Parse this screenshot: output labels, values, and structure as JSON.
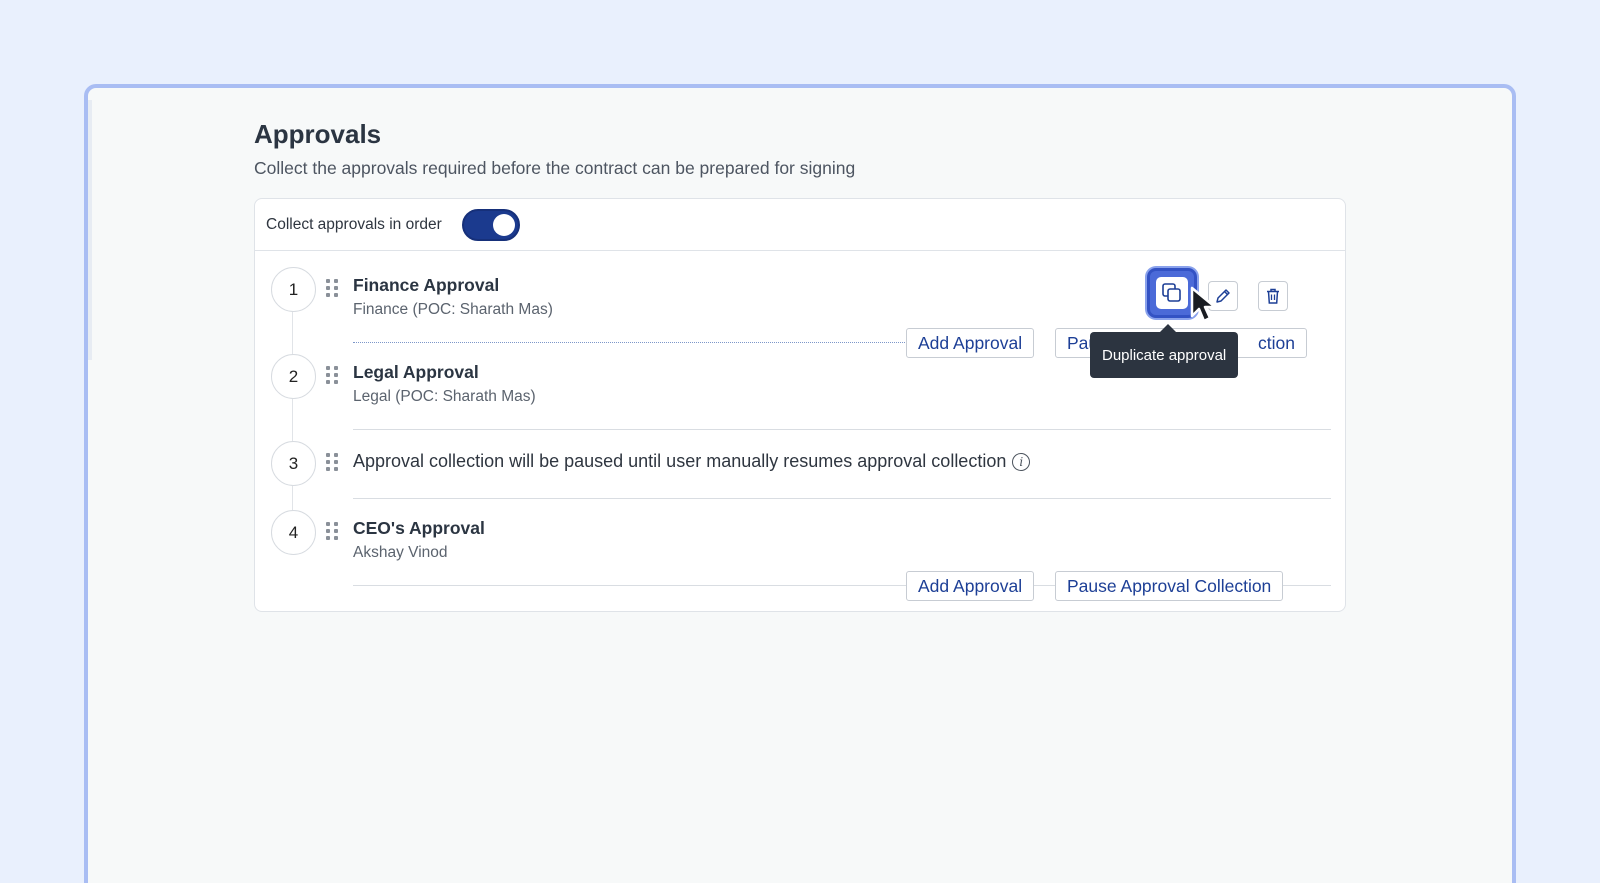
{
  "page": {
    "title": "Approvals",
    "subtitle": "Collect the approvals required before the contract can be prepared for signing"
  },
  "settings": {
    "collect_in_order_label": "Collect approvals in order",
    "collect_in_order_enabled": true
  },
  "steps": [
    {
      "number": "1",
      "title": "Finance Approval",
      "subtitle": "Finance (POC: Sharath Mas)"
    },
    {
      "number": "2",
      "title": "Legal Approval",
      "subtitle": "Legal (POC: Sharath Mas)"
    },
    {
      "number": "3",
      "pause_text": "Approval collection will be paused until user manually resumes approval collection"
    },
    {
      "number": "4",
      "title": "CEO's Approval",
      "subtitle": "Akshay Vinod"
    }
  ],
  "actions": {
    "add_approval": "Add Approval",
    "pause_collection": "Pause Approval Collection",
    "pause_partial_left": "Pau",
    "pause_partial_right": "ction"
  },
  "tooltip": {
    "text": "Duplicate approval"
  },
  "icons": {
    "duplicate": "duplicate-icon",
    "edit": "pencil-icon",
    "delete": "trash-icon",
    "info": "info-icon",
    "drag": "drag-handle-icon"
  },
  "colors": {
    "accent": "#1d3f96",
    "toggle_on": "#1b3a8e",
    "active_button": "#4b6ad8",
    "tooltip_bg": "#2c3440",
    "background": "#e9f0fd"
  }
}
